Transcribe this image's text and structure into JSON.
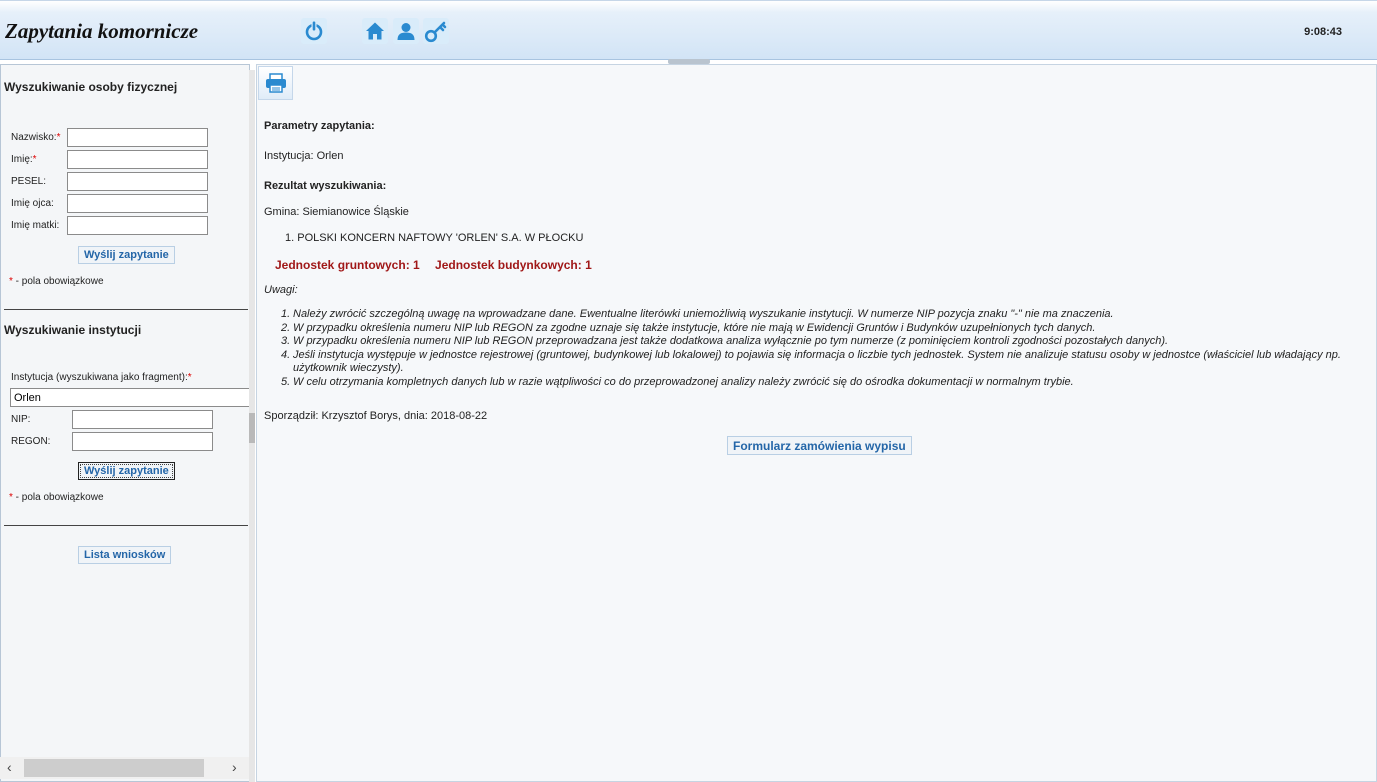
{
  "header": {
    "title": "Zapytania komornicze",
    "clock": "9:08:43",
    "icons": [
      "power-icon",
      "home-icon",
      "user-icon",
      "key-icon"
    ],
    "accent": "#2a8ad0"
  },
  "person_search": {
    "title": "Wyszukiwanie osoby fizycznej",
    "fields": [
      {
        "label": "Nazwisko:",
        "required": "*",
        "value": ""
      },
      {
        "label": "Imię:",
        "required": "*",
        "value": ""
      },
      {
        "label": "PESEL:",
        "required": "",
        "value": ""
      },
      {
        "label": "Imię ojca:",
        "required": "",
        "value": ""
      },
      {
        "label": "Imię matki:",
        "required": "",
        "value": ""
      }
    ],
    "submit_label": "Wyślij zapytanie",
    "required_note_star": "*",
    "required_note": " - pola obowiązkowe"
  },
  "institution_search": {
    "title": "Wyszukiwanie instytucji",
    "institution_label": "Instytucja (wyszukiwana jako fragment):",
    "institution_required": "*",
    "institution_value": "Orlen",
    "nip_label": "NIP:",
    "nip_value": "",
    "regon_label": "REGON:",
    "regon_value": "",
    "submit_label": "Wyślij zapytanie",
    "required_note_star": "*",
    "required_note": " - pola obowiązkowe"
  },
  "requests_list_label": "Lista wniosków",
  "main": {
    "params_title": "Parametry zapytania:",
    "institution_line": "Instytucja: Orlen",
    "result_title": "Rezultat wyszukiwania:",
    "gmina_line": "Gmina: Siemianowice Śląskie",
    "result_item": "1. POLSKI KONCERN NAFTOWY 'ORLEN' S.A. W PŁOCKU",
    "count_land": "Jednostek gruntowych: 1",
    "count_building": "Jednostek budynkowych: 1",
    "notes_title": "Uwagi:",
    "notes": [
      {
        "n": "1.",
        "text": "Należy zwrócić szczególną uwagę na wprowadzane dane. Ewentualne literówki uniemożliwią wyszukanie instytucji. W numerze NIP pozycja znaku \"-\" nie ma znaczenia."
      },
      {
        "n": "2.",
        "text": "W przypadku określenia numeru NIP lub REGON za zgodne uznaje się także instytucje, które nie mają w Ewidencji Gruntów i Budynków uzupełnionych tych danych."
      },
      {
        "n": "3.",
        "text": "W przypadku określenia numeru NIP lub REGON przeprowadzana jest także dodatkowa analiza wyłącznie po tym numerze (z pominięciem kontroli zgodności pozostałych danych)."
      },
      {
        "n": "4.",
        "text": "Jeśli instytucja występuje w jednostce rejestrowej (gruntowej, budynkowej lub lokalowej) to pojawia się informacja o liczbie tych jednostek. System nie analizuje statusu osoby w jednostce (właściciel lub władający np. użytkownik wieczysty)."
      },
      {
        "n": "5.",
        "text": "W celu otrzymania kompletnych danych lub w razie wątpliwości co do przeprowadzonej analizy należy zwrócić się do ośrodka dokumentacji w normalnym trybie."
      }
    ],
    "prepared_by": "Sporządził: Krzysztof Borys, dnia: 2018-08-22",
    "order_button": "Formularz zamówienia wypisu"
  }
}
